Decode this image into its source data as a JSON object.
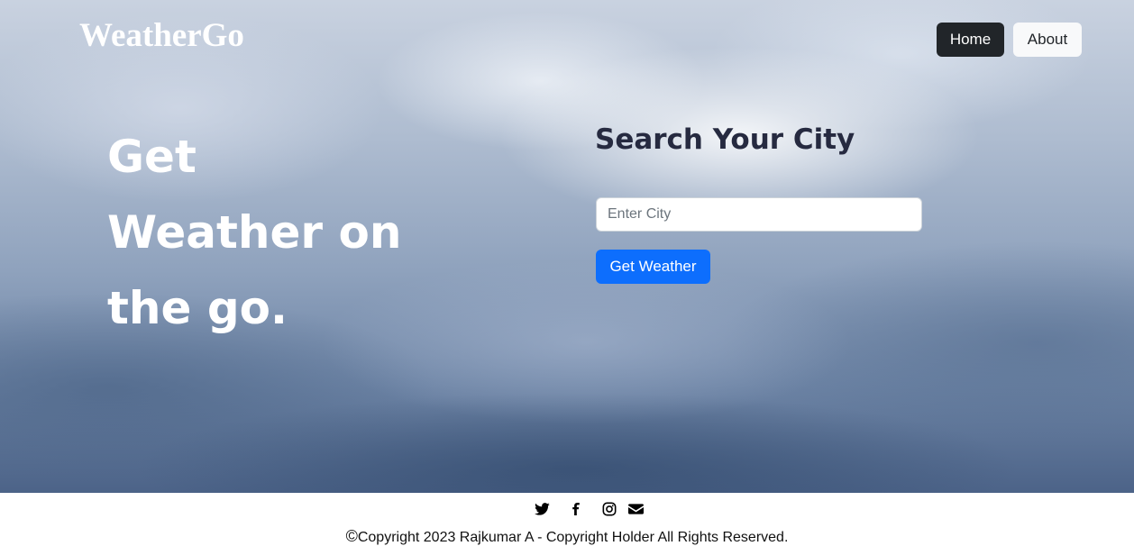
{
  "header": {
    "brand": "WeatherGo",
    "nav": [
      {
        "label": "Home",
        "active": true
      },
      {
        "label": "About",
        "active": false
      }
    ]
  },
  "hero": {
    "tagline_lines": [
      "Get",
      "Weather on",
      "the go."
    ]
  },
  "search": {
    "title": "Search Your City",
    "input_value": "",
    "input_placeholder": "Enter City",
    "button_label": "Get Weather"
  },
  "footer": {
    "social_icons": [
      "twitter-icon",
      "facebook-icon",
      "instagram-icon",
      "envelope-icon"
    ],
    "copyright_symbol": "©",
    "copyright_text": "Copyright 2023 Rajkumar A - Copyright Holder All Rights Reserved."
  },
  "colors": {
    "nav_active_bg": "#212529",
    "nav_inactive_bg": "#f8f9fa",
    "button_primary": "#0d6efd",
    "search_title": "#262a40",
    "hero_text": "#ffffff"
  }
}
